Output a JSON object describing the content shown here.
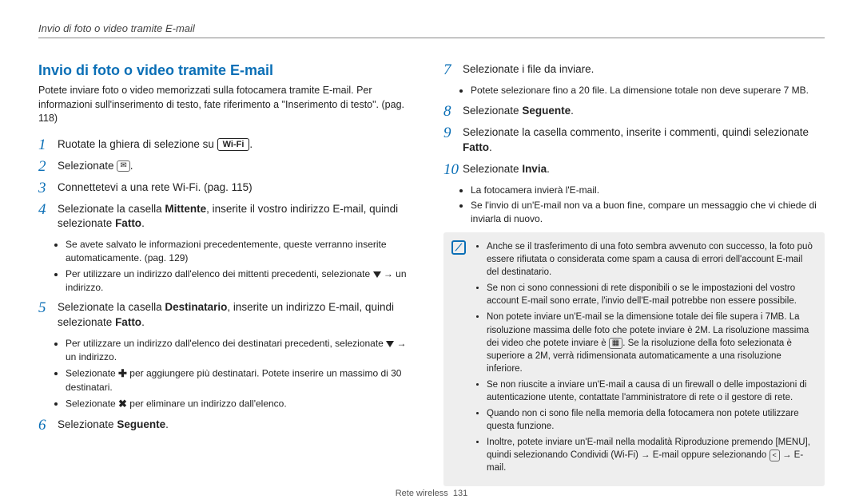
{
  "header": {
    "running_title": "Invio di foto o video tramite E-mail"
  },
  "left": {
    "heading": "Invio di foto o video tramite E-mail",
    "intro": "Potete inviare foto o video memorizzati sulla fotocamera tramite E-mail. Per informazioni sull'inserimento di testo, fate riferimento a \"Inserimento di testo\". (pag. 118)",
    "steps": {
      "s1_pre": "Ruotate la ghiera di selezione su ",
      "s1_wifi": "Wi-Fi",
      "s1_post": ".",
      "s2_pre": "Selezionate ",
      "s2_icon": "✉",
      "s2_post": ".",
      "s3": "Connettetevi a una rete Wi-Fi. (pag. 115)",
      "s4_a": "Selezionate la casella ",
      "s4_b": "Mittente",
      "s4_c": ", inserite il vostro indirizzo E-mail, quindi selezionate ",
      "s4_d": "Fatto",
      "s4_e": ".",
      "s4_bul1": "Se avete salvato le informazioni precedentemente, queste verranno inserite automaticamente. (pag. 129)",
      "s4_bul2a": "Per utilizzare un indirizzo dall'elenco dei mittenti precedenti, selezionate ",
      "s4_bul2b": " → un indirizzo.",
      "s5_a": "Selezionate la casella ",
      "s5_b": "Destinatario",
      "s5_c": ", inserite un indirizzo E-mail, quindi selezionate ",
      "s5_d": "Fatto",
      "s5_e": ".",
      "s5_bul1a": "Per utilizzare un indirizzo dall'elenco dei destinatari precedenti, selezionate ",
      "s5_bul1b": " → un indirizzo.",
      "s5_bul2a": "Selezionate ",
      "s5_bul2b": " per aggiungere più destinatari. Potete inserire un massimo di 30 destinatari.",
      "s5_bul3a": "Selezionate ",
      "s5_bul3b": " per eliminare un indirizzo dall'elenco.",
      "s6_a": "Selezionate ",
      "s6_b": "Seguente",
      "s6_c": "."
    }
  },
  "right": {
    "steps": {
      "s7": "Selezionate i file da inviare.",
      "s7_bul": "Potete selezionare fino a 20 file. La dimensione totale non deve superare 7 MB.",
      "s8_a": "Selezionate ",
      "s8_b": "Seguente",
      "s8_c": ".",
      "s9_a": "Selezionate la casella commento, inserite i commenti, quindi selezionate ",
      "s9_b": "Fatto",
      "s9_c": ".",
      "s10_a": "Selezionate ",
      "s10_b": "Invia",
      "s10_c": ".",
      "s10_bul1": "La fotocamera invierà l'E-mail.",
      "s10_bul2": "Se l'invio di un'E-mail non va a buon fine, compare un messaggio che vi chiede di inviarla di nuovo."
    },
    "note": {
      "n1": "Anche se il trasferimento di una foto sembra avvenuto con successo, la foto può essere rifiutata o considerata come spam a causa di errori dell'account E-mail del destinatario.",
      "n2": "Se non ci sono connessioni di rete disponibili o se le impostazioni del vostro account E-mail sono errate, l'invio dell'E-mail potrebbe non essere possibile.",
      "n3a": "Non potete inviare un'E-mail se la dimensione totale dei file supera i 7MB. La risoluzione massima delle foto che potete inviare è 2M. La risoluzione massima dei video che potete inviare è ",
      "n3b": ". Se la risoluzione della foto selezionata è superiore a 2M, verrà ridimensionata automaticamente a una risoluzione inferiore.",
      "n4": "Se non riuscite a inviare un'E-mail a causa di un firewall o delle impostazioni di autenticazione utente, contattate l'amministratore di rete o il gestore di rete.",
      "n5": "Quando non ci sono file nella memoria della fotocamera non potete utilizzare questa funzione.",
      "n6a": "Inoltre, potete inviare un'E-mail nella modalità Riproduzione premendo [",
      "n6menu": "MENU",
      "n6b": "], quindi selezionando ",
      "n6c": "Condividi (Wi-Fi)",
      "n6d": " → ",
      "n6e": "E-mail",
      "n6f": " oppure selezionando ",
      "n6g": " → ",
      "n6h": "E-mail",
      "n6i": "."
    }
  },
  "footer": {
    "section": "Rete wireless",
    "page": "131"
  }
}
